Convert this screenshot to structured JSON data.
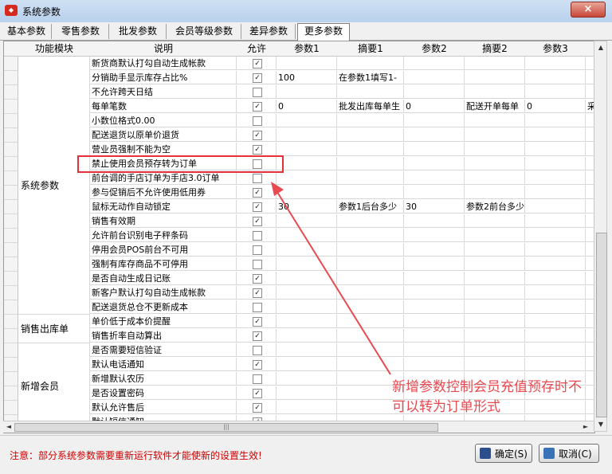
{
  "window": {
    "title": "系统参数",
    "close_symbol": "×",
    "app_icon": "app-logo-icon"
  },
  "tabs": [
    {
      "label": "基本参数"
    },
    {
      "label": "零售参数"
    },
    {
      "label": "批发参数"
    },
    {
      "label": "会员等级参数"
    },
    {
      "label": "差异参数"
    },
    {
      "label": "更多参数",
      "active": true
    }
  ],
  "grid": {
    "headers": [
      "功能模块",
      "说明",
      "允许",
      "参数1",
      "摘要1",
      "参数2",
      "摘要2",
      "参数3"
    ],
    "modules": [
      "系统参数",
      "销售出库单",
      "新增会员"
    ],
    "rows": [
      {
        "desc": "新货商默认打勾自动生成帐款",
        "checked": true,
        "p1": "",
        "s1": "",
        "p2": "",
        "s2": "",
        "p3": ""
      },
      {
        "desc": "分销助手显示库存占比%",
        "checked": true,
        "p1": "100",
        "s1": "在参数1填写1-",
        "p2": "",
        "s2": "",
        "p3": ""
      },
      {
        "desc": "不允许跨天日结",
        "checked": false,
        "p1": "",
        "s1": "",
        "p2": "",
        "s2": "",
        "p3": ""
      },
      {
        "desc": "每单笔数",
        "checked": true,
        "p1": "0",
        "s1": "批发出库每单生",
        "p2": "0",
        "s2": "配送开单每单",
        "p3": "0",
        "extra": "采"
      },
      {
        "desc": "小数位格式0.00",
        "checked": false,
        "p1": "",
        "s1": "",
        "p2": "",
        "s2": "",
        "p3": ""
      },
      {
        "desc": "配送退货以原单价退货",
        "checked": true,
        "p1": "",
        "s1": "",
        "p2": "",
        "s2": "",
        "p3": ""
      },
      {
        "desc": "营业员强制不能为空",
        "checked": true,
        "p1": "",
        "s1": "",
        "p2": "",
        "s2": "",
        "p3": ""
      },
      {
        "desc": "禁止使用会员预存转为订单",
        "checked": false,
        "p1": "",
        "s1": "",
        "p2": "",
        "s2": "",
        "p3": ""
      },
      {
        "desc": "前台调的手店订单为手店3.0订单",
        "checked": false,
        "p1": "",
        "s1": "",
        "p2": "",
        "s2": "",
        "p3": ""
      },
      {
        "desc": "参与促销后不允许使用低用券",
        "checked": true,
        "p1": "",
        "s1": "",
        "p2": "",
        "s2": "",
        "p3": ""
      },
      {
        "desc": "鼠标无动作自动锁定",
        "checked": true,
        "p1": "30",
        "s1": "参数1后台多少",
        "p2": "30",
        "s2": "参数2前台多少",
        "p3": ""
      },
      {
        "desc": "销售有效期",
        "checked": true,
        "p1": "",
        "s1": "",
        "p2": "",
        "s2": "",
        "p3": ""
      },
      {
        "desc": "允许前台识别电子秤条码",
        "checked": false,
        "p1": "",
        "s1": "",
        "p2": "",
        "s2": "",
        "p3": ""
      },
      {
        "desc": "停用会员POS前台不可用",
        "checked": false,
        "p1": "",
        "s1": "",
        "p2": "",
        "s2": "",
        "p3": ""
      },
      {
        "desc": "强制有库存商品不可停用",
        "checked": false,
        "p1": "",
        "s1": "",
        "p2": "",
        "s2": "",
        "p3": ""
      },
      {
        "desc": "是否自动生成日记账",
        "checked": true,
        "p1": "",
        "s1": "",
        "p2": "",
        "s2": "",
        "p3": ""
      },
      {
        "desc": "新客户默认打勾自动生成帐款",
        "checked": true,
        "p1": "",
        "s1": "",
        "p2": "",
        "s2": "",
        "p3": ""
      },
      {
        "desc": "配送退货总仓不更新成本",
        "checked": false,
        "p1": "",
        "s1": "",
        "p2": "",
        "s2": "",
        "p3": ""
      },
      {
        "desc": "单价低于成本价提醒",
        "checked": true,
        "p1": "",
        "s1": "",
        "p2": "",
        "s2": "",
        "p3": ""
      },
      {
        "desc": "销售折率自动算出",
        "checked": true,
        "p1": "",
        "s1": "",
        "p2": "",
        "s2": "",
        "p3": ""
      },
      {
        "desc": "是否需要短信验证",
        "checked": false,
        "p1": "",
        "s1": "",
        "p2": "",
        "s2": "",
        "p3": ""
      },
      {
        "desc": "默认电话通知",
        "checked": true,
        "p1": "",
        "s1": "",
        "p2": "",
        "s2": "",
        "p3": ""
      },
      {
        "desc": "新增默认农历",
        "checked": false,
        "p1": "",
        "s1": "",
        "p2": "",
        "s2": "",
        "p3": ""
      },
      {
        "desc": "是否设置密码",
        "checked": true,
        "p1": "",
        "s1": "",
        "p2": "",
        "s2": "",
        "p3": ""
      },
      {
        "desc": "默认允许售后",
        "checked": true,
        "p1": "",
        "s1": "",
        "p2": "",
        "s2": "",
        "p3": ""
      },
      {
        "desc": "默认短信通知",
        "checked": true,
        "p1": "",
        "s1": "",
        "p2": "",
        "s2": "",
        "p3": ""
      }
    ]
  },
  "scroll_glyphs": {
    "up": "▲",
    "down": "▼",
    "left": "◄",
    "right": "►",
    "grip": "|||"
  },
  "footer": {
    "note": "注意：部分系统参数需要重新运行软件才能使新的设置生效!",
    "ok_label": "确定(S)",
    "cancel_label": "取消(C)"
  },
  "annotation": {
    "line1": "新增参数控制会员充值预存时不",
    "line2": "可以转为订单形式",
    "color": "#e84a50"
  }
}
